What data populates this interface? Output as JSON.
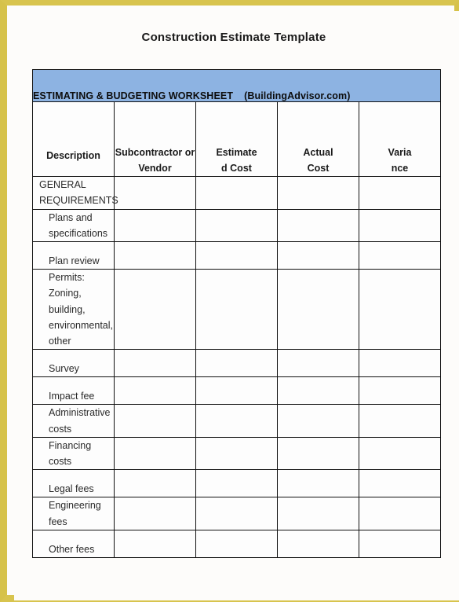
{
  "document": {
    "title": "Construction Estimate Template",
    "frame_color": "#d6c24a",
    "banner_color": "#8db3e2"
  },
  "worksheet": {
    "banner_title": "ESTIMATING & BUDGETING  WORKSHEET",
    "banner_source": "(BuildingAdvisor.com)",
    "columns": [
      {
        "label": "Description",
        "key": "description"
      },
      {
        "label_line1": "Subcontractor  or",
        "label_line2": "Vendor",
        "key": "subcontractor"
      },
      {
        "label_line1": "Estimate",
        "label_line2": "d Cost",
        "key": "estimated_cost"
      },
      {
        "label_line1": "Actual",
        "label_line2": "Cost",
        "key": "actual_cost"
      },
      {
        "label_line1": "Varia",
        "label_line2": "nce",
        "key": "variance"
      }
    ],
    "rows": [
      {
        "description": "GENERAL REQUIREMENTS",
        "type": "section",
        "subcontractor": "",
        "estimated_cost": "",
        "actual_cost": "",
        "variance": ""
      },
      {
        "description": "Plans and specifications",
        "type": "item",
        "subcontractor": "",
        "estimated_cost": "",
        "actual_cost": "",
        "variance": ""
      },
      {
        "description": "Plan review",
        "type": "item",
        "subcontractor": "",
        "estimated_cost": "",
        "actual_cost": "",
        "variance": ""
      },
      {
        "description_line1": "Permits:  Zoning, building,",
        "description_line2": "environmental, other",
        "type": "item-tall",
        "subcontractor": "",
        "estimated_cost": "",
        "actual_cost": "",
        "variance": ""
      },
      {
        "description": "Survey",
        "type": "item",
        "subcontractor": "",
        "estimated_cost": "",
        "actual_cost": "",
        "variance": ""
      },
      {
        "description": "Impact fee",
        "type": "item",
        "subcontractor": "",
        "estimated_cost": "",
        "actual_cost": "",
        "variance": ""
      },
      {
        "description": "Administrative costs",
        "type": "item",
        "subcontractor": "",
        "estimated_cost": "",
        "actual_cost": "",
        "variance": ""
      },
      {
        "description": "Financing costs",
        "type": "item",
        "subcontractor": "",
        "estimated_cost": "",
        "actual_cost": "",
        "variance": ""
      },
      {
        "description": "Legal fees",
        "type": "item",
        "subcontractor": "",
        "estimated_cost": "",
        "actual_cost": "",
        "variance": ""
      },
      {
        "description": "Engineering fees",
        "type": "item",
        "subcontractor": "",
        "estimated_cost": "",
        "actual_cost": "",
        "variance": ""
      },
      {
        "description": "Other fees",
        "type": "item",
        "subcontractor": "",
        "estimated_cost": "",
        "actual_cost": "",
        "variance": ""
      }
    ],
    "watermark_text": ""
  }
}
